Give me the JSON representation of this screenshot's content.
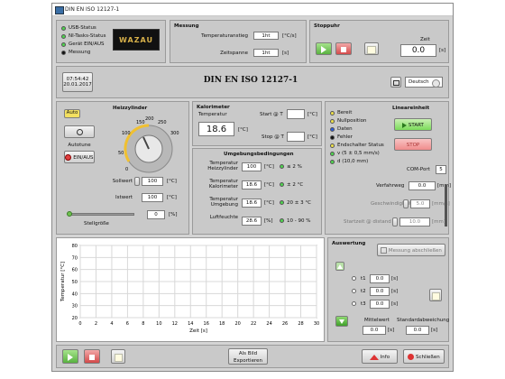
{
  "window": {
    "title": "DIN EN ISO 12127-1"
  },
  "status": {
    "items": [
      {
        "label": "USB-Status",
        "led": "green"
      },
      {
        "label": "NI-Tasks-Status",
        "led": "green"
      },
      {
        "label": "Gerät EIN/AUS",
        "led": "green"
      },
      {
        "label": "Messung",
        "led": "black"
      }
    ],
    "logo": "WAZAU"
  },
  "messung": {
    "title": "Messung",
    "rate_label": "Temperaturanstieg",
    "rate_value": "1ht",
    "rate_unit": "[°C/s]",
    "span_label": "Zeitspanne",
    "span_value": "1ht",
    "span_unit": "[s]"
  },
  "stoppuhr": {
    "title": "Stoppuhr",
    "time_label": "Zeit",
    "time_value": "0.0",
    "time_unit": "[s]"
  },
  "header": {
    "datetime_line1": "07:54:42",
    "datetime_line2": "20.01.2017",
    "standard": "DIN EN ISO 12127-1",
    "language": "Deutsch"
  },
  "heizzylinder": {
    "title": "Heizzylinder",
    "auto_label": "Auto",
    "autotune_label": "Autotune",
    "ein_aus_label": "EIN/AUS",
    "dial_ticks": [
      "100",
      "150",
      "200",
      "250",
      "300",
      "50",
      "0"
    ],
    "sollwert_label": "Sollwert",
    "sollwert_value": "100",
    "sollwert_unit": "[°C]",
    "istwert_label": "Istwert",
    "istwert_value": "100",
    "istwert_unit": "[°C]",
    "stell_label": "Stellgröße",
    "stell_value": "0",
    "stell_unit": "[%]"
  },
  "kalorimeter": {
    "title": "Kalorimeter",
    "temp_label": "Temperatur",
    "temp_value": "18.6",
    "temp_unit": "[°C]",
    "start_label": "Start @ T",
    "stop_label": "Stop @ T",
    "unit": "[°C]"
  },
  "umgebung": {
    "title": "Umgebungsbedingungen",
    "rows": [
      {
        "label": "Temperatur Heizzylinder",
        "value": "100",
        "unit": "[°C]",
        "tol": "≤ 2 %"
      },
      {
        "label": "Temperatur Kalorimeter",
        "value": "18.6",
        "unit": "[°C]",
        "tol": "± 2 °C"
      },
      {
        "label": "Temperatur Umgebung",
        "value": "18.6",
        "unit": "[°C]",
        "tol": "20 ± 3 °C"
      },
      {
        "label": "Luftfeuchte",
        "value": "28.6",
        "unit": "[%]",
        "tol": "10 - 90 %"
      }
    ]
  },
  "linear": {
    "title": "Lineareinheit",
    "leds": [
      {
        "label": "Bereit",
        "led": "yellow"
      },
      {
        "label": "Nullposition",
        "led": "yellow"
      },
      {
        "label": "Daten",
        "led": "blue"
      },
      {
        "label": "Fehler",
        "led": "black"
      },
      {
        "label": "Endschalter Status",
        "led": "yellow"
      },
      {
        "label": "v (5 ± 0,5 mm/s)",
        "led": "green"
      },
      {
        "label": "d (10,0 mm)",
        "led": "green"
      }
    ],
    "start_label": "START",
    "stop_label": "STOP",
    "com_label": "COM-Port",
    "com_value": "5",
    "verfahr_label": "Verfahrweg",
    "verfahr_value": "0.0",
    "mm_unit": "[mm]",
    "geschw_label": "Geschwindigkeit",
    "geschw_value": "5.0",
    "geschw_unit": "[mm/s]",
    "abstand_label": "Startzeit @ distand",
    "abstand_value": "10.0",
    "abstand_unit": "[mm]"
  },
  "auswertung": {
    "title": "Auswertung",
    "messung_btn": "Messung abschließen",
    "t_rows": [
      {
        "label": "t1",
        "value": "0.0",
        "unit": "[s]"
      },
      {
        "label": "t2",
        "value": "0.0",
        "unit": "[s]"
      },
      {
        "label": "t3",
        "value": "0.0",
        "unit": "[s]"
      }
    ],
    "mittel_label": "Mittelwert",
    "mittel_value": "0.0",
    "std_label": "Standardabweichung",
    "std_value": "0.0",
    "unit": "[s]"
  },
  "chart_data": {
    "type": "line",
    "ylabel": "Temperatur [°C]",
    "xlabel": "Zeit [s]",
    "x_ticks": [
      "0",
      "2",
      "4",
      "6",
      "8",
      "10",
      "12",
      "14",
      "16",
      "18",
      "20",
      "22",
      "24",
      "26",
      "28",
      "30"
    ],
    "y_ticks": [
      "80",
      "70",
      "60",
      "50",
      "40",
      "30",
      "20"
    ],
    "xlim": [
      0,
      30
    ],
    "ylim": [
      20,
      80
    ],
    "series": []
  },
  "footer": {
    "export_label": "Als Bild Exportieren",
    "info_label": "Info",
    "close_label": "Schließen"
  },
  "colors": {
    "accent_green": "#4fd34f",
    "accent_red": "#e04040",
    "start_green": "#7bdc5a",
    "stop_red": "#f08c8c",
    "led_yellow": "#f0e24a"
  }
}
